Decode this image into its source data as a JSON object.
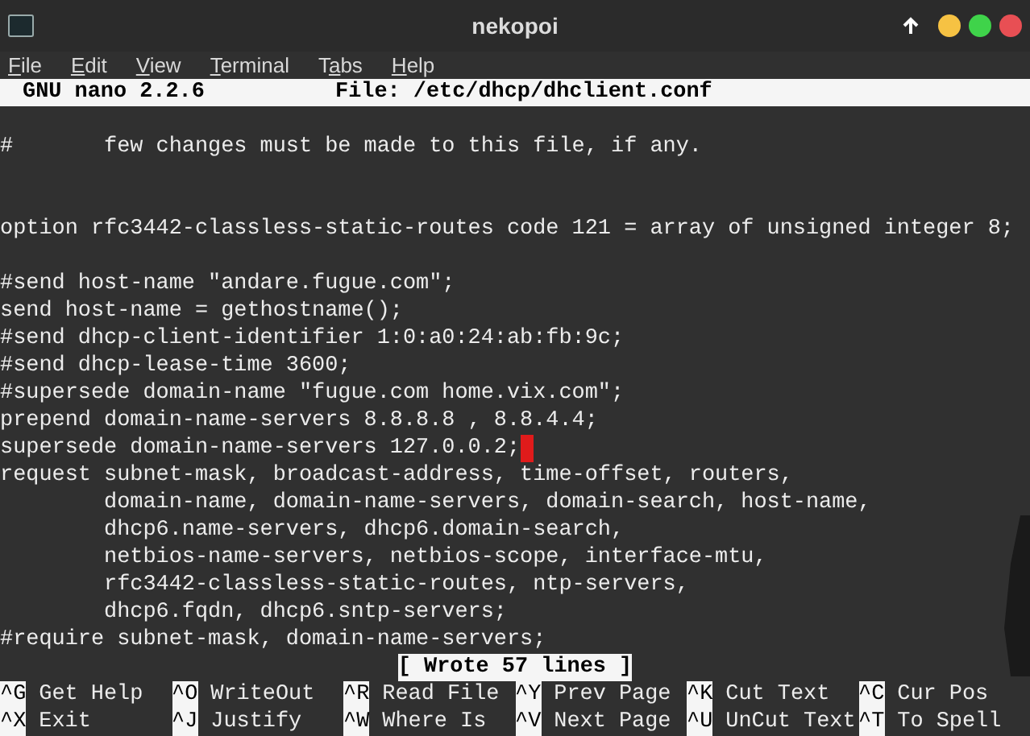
{
  "window": {
    "title": "nekopoi"
  },
  "menu": [
    {
      "accel": "F",
      "after": "ile"
    },
    {
      "accel": "E",
      "after": "dit"
    },
    {
      "accel": "V",
      "after": "iew"
    },
    {
      "accel": "T",
      "after": "erminal"
    },
    {
      "before": "T",
      "accel": "a",
      "after": "bs"
    },
    {
      "accel": "H",
      "after": "elp"
    }
  ],
  "nano_header": {
    "version": "GNU nano 2.2.6",
    "file": "File: /etc/dhcp/dhclient.conf"
  },
  "lines": [
    {
      "kind": "blank"
    },
    {
      "kind": "text",
      "text": "#       few changes must be made to this file, if any."
    },
    {
      "kind": "blank"
    },
    {
      "kind": "blank"
    },
    {
      "kind": "text",
      "text": "option rfc3442-classless-static-routes code 121 = array of unsigned integer 8;"
    },
    {
      "kind": "blank"
    },
    {
      "kind": "text",
      "text": "#send host-name \"andare.fugue.com\";"
    },
    {
      "kind": "text",
      "text": "send host-name = gethostname();"
    },
    {
      "kind": "text",
      "text": "#send dhcp-client-identifier 1:0:a0:24:ab:fb:9c;"
    },
    {
      "kind": "text",
      "text": "#send dhcp-lease-time 3600;"
    },
    {
      "kind": "text",
      "text": "#supersede domain-name \"fugue.com home.vix.com\";"
    },
    {
      "kind": "text",
      "text": "prepend domain-name-servers 8.8.8.8 , 8.8.4.4;"
    },
    {
      "kind": "text",
      "text": "supersede domain-name-servers 127.0.0.2;",
      "cursor": true
    },
    {
      "kind": "text",
      "text": "request subnet-mask, broadcast-address, time-offset, routers,"
    },
    {
      "kind": "text",
      "text": "        domain-name, domain-name-servers, domain-search, host-name,"
    },
    {
      "kind": "text",
      "text": "        dhcp6.name-servers, dhcp6.domain-search,"
    },
    {
      "kind": "text",
      "text": "        netbios-name-servers, netbios-scope, interface-mtu,"
    },
    {
      "kind": "text",
      "text": "        rfc3442-classless-static-routes, ntp-servers,"
    },
    {
      "kind": "text",
      "text": "        dhcp6.fqdn, dhcp6.sntp-servers;"
    },
    {
      "kind": "text",
      "text": "#require subnet-mask, domain-name-servers;"
    }
  ],
  "status_message": "[ Wrote 57 lines ]",
  "shortcuts": [
    {
      "key": "^G",
      "label": "Get Help"
    },
    {
      "key": "^O",
      "label": "WriteOut"
    },
    {
      "key": "^R",
      "label": "Read File"
    },
    {
      "key": "^Y",
      "label": "Prev Page"
    },
    {
      "key": "^K",
      "label": "Cut Text"
    },
    {
      "key": "^C",
      "label": "Cur Pos"
    },
    {
      "key": "^X",
      "label": "Exit"
    },
    {
      "key": "^J",
      "label": "Justify"
    },
    {
      "key": "^W",
      "label": "Where Is"
    },
    {
      "key": "^V",
      "label": "Next Page"
    },
    {
      "key": "^U",
      "label": "UnCut Text"
    },
    {
      "key": "^T",
      "label": "To Spell"
    }
  ]
}
